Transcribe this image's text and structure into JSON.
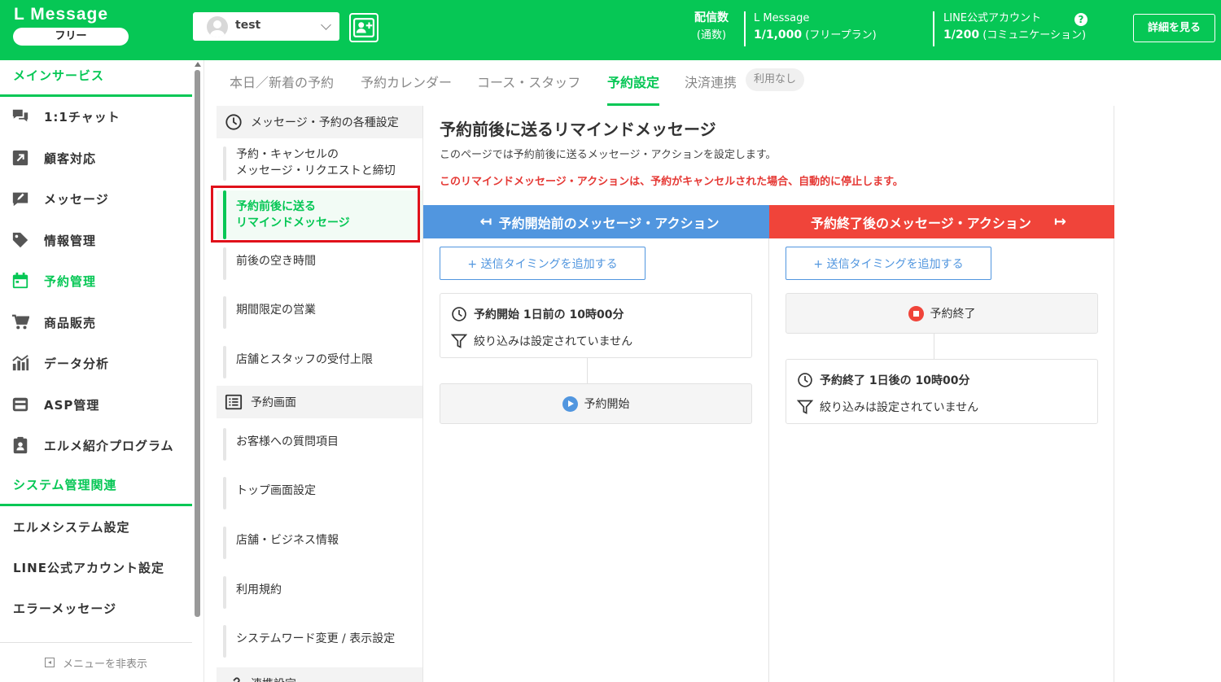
{
  "header": {
    "brand": "L Message",
    "plan": "フリー",
    "account_name": "test",
    "stat_label_1": "配信数",
    "stat_label_2": "(通数)",
    "lm_label": "L Message",
    "lm_value": "1/1,000",
    "lm_plan": "(フリープラン)",
    "line_label": "LINE公式アカウント",
    "line_value": "1/200",
    "line_plan": "(コミュニケーション)",
    "help": "?",
    "detail_button": "詳細を見る",
    "accent_color": "#06C755"
  },
  "sidebar": {
    "section_main": "メインサービス",
    "items": [
      {
        "label": "1:1チャット",
        "icon": "chat-icon"
      },
      {
        "label": "顧客対応",
        "icon": "external-link-icon"
      },
      {
        "label": "メッセージ",
        "icon": "edit-message-icon"
      },
      {
        "label": "情報管理",
        "icon": "tag-icon"
      },
      {
        "label": "予約管理",
        "icon": "calendar-icon"
      },
      {
        "label": "商品販売",
        "icon": "cart-icon"
      },
      {
        "label": "データ分析",
        "icon": "chart-icon"
      },
      {
        "label": "ASP管理",
        "icon": "asp-icon"
      },
      {
        "label": "エルメ紹介プログラム",
        "icon": "clipboard-user-icon"
      }
    ],
    "section_system": "システム管理関連",
    "system_items": [
      "エルメシステム設定",
      "LINE公式アカウント設定",
      "エラーメッセージ"
    ],
    "hide_menu": "メニューを非表示"
  },
  "tabs": {
    "items": [
      "本日／新着の予約",
      "予約カレンダー",
      "コース・スタッフ",
      "予約設定",
      "決済連携"
    ],
    "badge": "利用なし"
  },
  "subnav": {
    "head_message": "メッセージ・予約の各種設定",
    "item_cancel_1": "予約・キャンセルの",
    "item_cancel_2": "メッセージ・リクエストと締切",
    "item_remind_1": "予約前後に送る",
    "item_remind_2": "リマインドメッセージ",
    "item_gap": "前後の空き時間",
    "item_limited": "期間限定の営業",
    "item_cap": "店舗とスタッフの受付上限",
    "head_screen": "予約画面",
    "item_questions": "お客様への質問項目",
    "item_top": "トップ画面設定",
    "item_store": "店舗・ビジネス情報",
    "item_terms": "利用規約",
    "item_words": "システムワード変更 / 表示設定",
    "head_link": "連携設定"
  },
  "main": {
    "title": "予約前後に送るリマインドメッセージ",
    "description": "このページでは予約前後に送るメッセージ・アクションを設定します。",
    "warning": "このリマインドメッセージ・アクションは、予約がキャンセルされた場合、自動的に停止します。",
    "before_header": "予約開始前のメッセージ・アクション",
    "after_header": "予約終了後のメッセージ・アクション",
    "add_timing": "+ 送信タイミングを追加する",
    "before_card_time": "予約開始 1日前の 10時00分",
    "filter_none": "絞り込みは設定されていません",
    "start_label": "予約開始",
    "end_label": "予約終了",
    "after_card_time": "予約終了 1日後の 10時00分",
    "before_color": "#5196df",
    "after_color": "#f0443a"
  }
}
